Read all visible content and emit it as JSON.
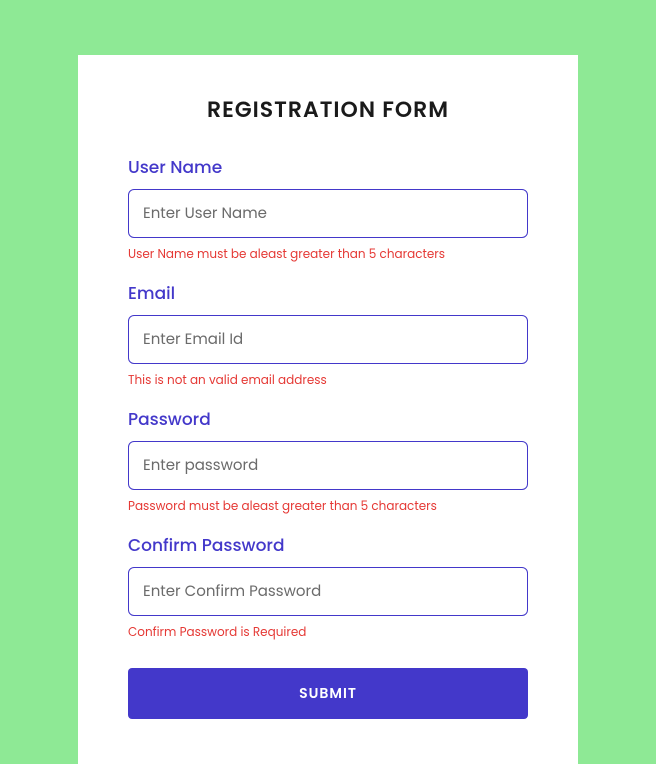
{
  "form": {
    "title": "REGISTRATION FORM",
    "fields": {
      "username": {
        "label": "User Name",
        "placeholder": "Enter User Name",
        "error": "User Name must be aleast greater than 5 characters"
      },
      "email": {
        "label": "Email",
        "placeholder": "Enter Email Id",
        "error": "This is not an valid email address"
      },
      "password": {
        "label": "Password",
        "placeholder": "Enter password",
        "error": "Password must be aleast greater than 5 characters"
      },
      "confirm_password": {
        "label": "Confirm Password",
        "placeholder": "Enter Confirm Password",
        "error": "Confirm Password is Required"
      }
    },
    "submit_label": "SUBMIT"
  }
}
